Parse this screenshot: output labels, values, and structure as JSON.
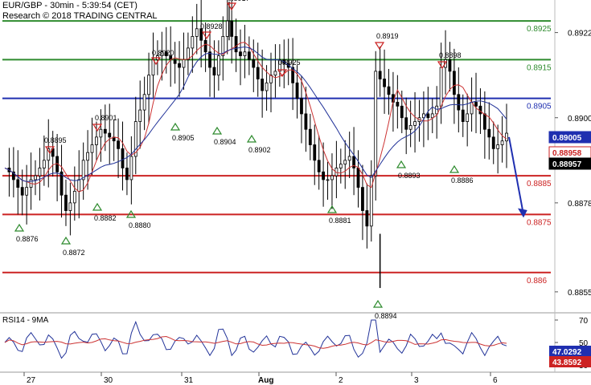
{
  "header": {
    "line1": "EUR/GBP - 30min - 5:39:54 (CET)",
    "line2": "Research © 2018 TRADING CENTRAL"
  },
  "chart_data": [
    {
      "type": "line",
      "subtype": "candlestick-with-levels",
      "title": "EUR/GBP - 30min - 5:39:54 (CET)",
      "ylim": [
        0.885,
        0.893
      ],
      "y_ticks": [
        0.8855,
        0.8878,
        0.89,
        0.8922
      ],
      "x_ticks": [
        "27",
        "30",
        "31",
        "Aug",
        "2",
        "3",
        "6"
      ],
      "horizontal_levels": [
        {
          "value": 0.8925,
          "label": "0.8925",
          "color": "#2e8b2e"
        },
        {
          "value": 0.8915,
          "label": "0.8915",
          "color": "#2e8b2e"
        },
        {
          "value": 0.8905,
          "label": "0.8905",
          "color": "#1f2fb0"
        },
        {
          "value": 0.8885,
          "label": "0.8885",
          "color": "#cc2222"
        },
        {
          "value": 0.8875,
          "label": "0.8875",
          "color": "#cc2222"
        },
        {
          "value": 0.886,
          "label": "0.886",
          "color": "#cc2222"
        }
      ],
      "price_tags": [
        {
          "value": 0.89005,
          "label": "0.89005",
          "bg": "#1f2fb0",
          "fg": "#ffffff"
        },
        {
          "value": 0.88958,
          "label": "0.88958",
          "bg": "#ffffff",
          "fg": "#cc2222"
        },
        {
          "value": 0.88957,
          "label": "0.88957",
          "bg": "#000000",
          "fg": "#ffffff"
        }
      ],
      "peaks": [
        {
          "label": "0.8895"
        },
        {
          "label": "0.8901"
        },
        {
          "label": "0.8920"
        },
        {
          "label": "0.8928"
        },
        {
          "label": "0.8917"
        },
        {
          "label": "0.8925"
        },
        {
          "label": "0.8919"
        },
        {
          "label": "0.8898"
        }
      ],
      "troughs": [
        {
          "label": "0.8876"
        },
        {
          "label": "0.8872"
        },
        {
          "label": "0.8882"
        },
        {
          "label": "0.8880"
        },
        {
          "label": "0.8905"
        },
        {
          "label": "0.8904"
        },
        {
          "label": "0.8902"
        },
        {
          "label": "0.8881"
        },
        {
          "label": "0.8894"
        },
        {
          "label": "0.8893"
        },
        {
          "label": "0.8886"
        }
      ],
      "forecast_arrow": {
        "from": 0.8895,
        "to": 0.8875,
        "color": "#1f2fb0"
      },
      "series": [
        {
          "name": "EUR/GBP",
          "values": [
            0.8887,
            0.8886,
            0.8884,
            0.8882,
            0.888,
            0.8882,
            0.8884,
            0.8885,
            0.8887,
            0.8889,
            0.8892,
            0.889,
            0.8886,
            0.888,
            0.8876,
            0.8878,
            0.8881,
            0.8884,
            0.8889,
            0.8891,
            0.8893,
            0.8895,
            0.8897,
            0.8896,
            0.8895,
            0.8894,
            0.8892,
            0.8887,
            0.8884,
            0.889,
            0.8899,
            0.8902,
            0.8906,
            0.8911,
            0.8915,
            0.8916,
            0.8917,
            0.8916,
            0.8915,
            0.8914,
            0.8913,
            0.8915,
            0.8918,
            0.8921,
            0.8923,
            0.892,
            0.8917,
            0.8913,
            0.8911,
            0.8916,
            0.8921,
            0.8925,
            0.8921,
            0.8917,
            0.8916,
            0.8917,
            0.8915,
            0.8913,
            0.891,
            0.8907,
            0.8909,
            0.8911,
            0.8912,
            0.8915,
            0.8914,
            0.8913,
            0.8909,
            0.8905,
            0.8901,
            0.8897,
            0.8893,
            0.8889,
            0.8886,
            0.8884,
            0.8884,
            0.8885,
            0.8887,
            0.8888,
            0.8889,
            0.889,
            0.8887,
            0.8882,
            0.8876,
            0.8872,
            0.8885,
            0.8912,
            0.891,
            0.8908,
            0.8906,
            0.8904,
            0.8903,
            0.89,
            0.8897,
            0.8898,
            0.8899,
            0.89,
            0.8901,
            0.89,
            0.8901,
            0.8903,
            0.8913,
            0.8915,
            0.8912,
            0.8906,
            0.8902,
            0.8899,
            0.8901,
            0.8904,
            0.8903,
            0.8901,
            0.8897,
            0.8895,
            0.8892,
            0.8893,
            0.8894,
            0.8896
          ]
        }
      ]
    },
    {
      "type": "line",
      "title": "RSI14 - 9MA",
      "ylim": [
        25,
        75
      ],
      "y_ticks": [
        30,
        50,
        70
      ],
      "price_tags": [
        {
          "value": 47.0292,
          "label": "47.0292",
          "bg": "#1f2fb0",
          "fg": "#ffffff"
        },
        {
          "value": 43.8592,
          "label": "43.8592",
          "bg": "#cc2222",
          "fg": "#ffffff"
        }
      ]
    }
  ]
}
